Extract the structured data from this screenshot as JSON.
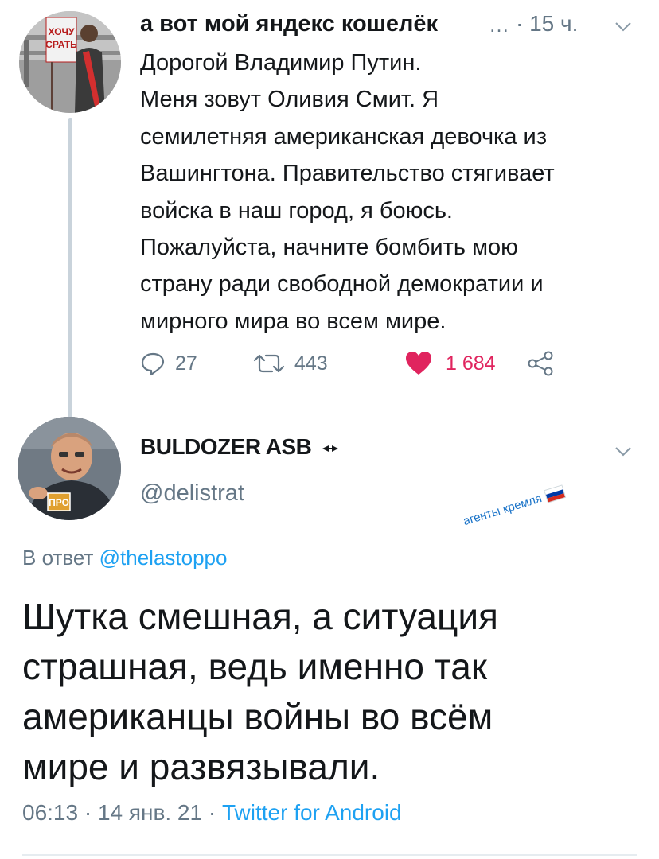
{
  "tweet1": {
    "author_name": "а вот мой яндекс кошелёк",
    "ellipsis": "…",
    "time": "· 15 ч.",
    "avatar": {
      "sign_text": "ХОЧУ СРАТЬ"
    },
    "text_lines": [
      "Дорогой Владимир Путин.",
      "Меня зовут Оливия Смит. Я",
      "семилетняя американская девочка из",
      "Вашингтона. Правительство стягивает",
      "войска в наш город, я боюсь.",
      "Пожалуйста, начните бомбить мою",
      "страну ради свободной демократии и",
      "мирного мира во всем мире."
    ],
    "actions": {
      "replies": "27",
      "retweets": "443",
      "likes": "1 684",
      "reply_icon": "reply-icon",
      "retweet_icon": "retweet-icon",
      "like_icon": "heart-icon",
      "share_icon": "share-icon"
    },
    "like_color": "#e0245e"
  },
  "tweet2": {
    "author_name": "BULDOZER ASB",
    "badge_icon": "chain-icon",
    "handle": "@delistrat",
    "avatar": {
      "badge_text": "ПРО"
    },
    "sticker_text": "агенты кремля",
    "reply_prefix": "В ответ",
    "reply_to": "@thelastoppo",
    "text_lines": [
      "Шутка смешная, а ситуация",
      "страшная, ведь именно так",
      "американцы войны во всём",
      "мире и развязывали."
    ],
    "meta_time": "06:13 · 14 янв. 21 ·",
    "meta_source": "Twitter for Android"
  },
  "colors": {
    "text": "#14171a",
    "secondary": "#657786",
    "link": "#1da1f2",
    "thread_line": "#c9d3db"
  }
}
